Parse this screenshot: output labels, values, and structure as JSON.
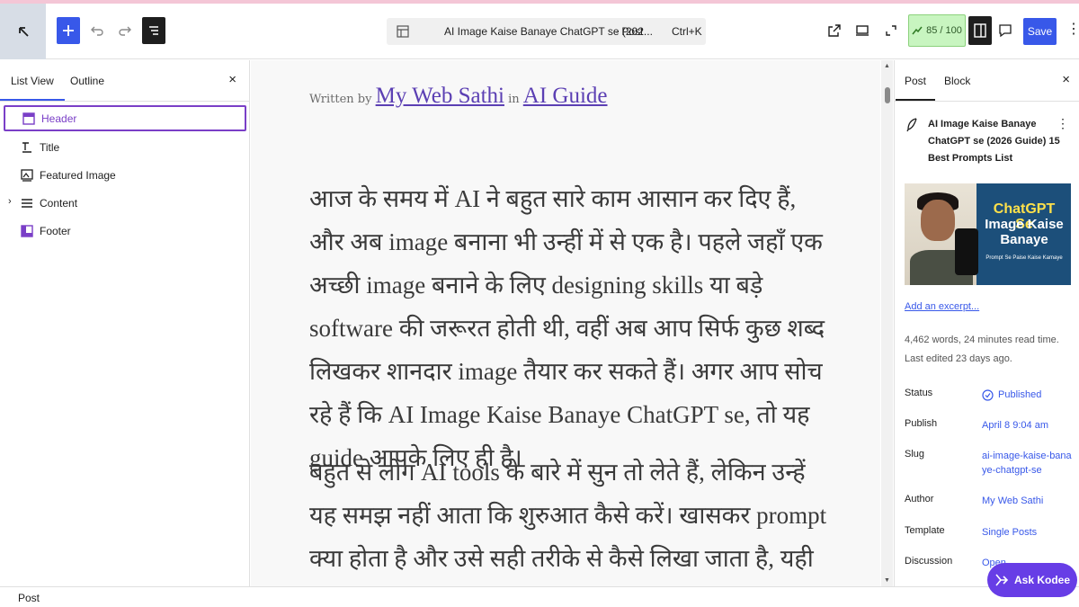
{
  "toolbar": {
    "doc_title": "AI Image Kaise Banaye ChatGPT se (202...",
    "doc_type": "· Post",
    "doc_shortcut": "Ctrl+K",
    "seo_score": "85 / 100",
    "save_label": "Save",
    "more_glyph": "⋮"
  },
  "left_panel": {
    "tabs": [
      {
        "label": "List View"
      },
      {
        "label": "Outline"
      }
    ],
    "close_glyph": "×",
    "items": [
      {
        "label": "Header"
      },
      {
        "label": "Title"
      },
      {
        "label": "Featured Image"
      },
      {
        "label": "Content"
      },
      {
        "label": "Footer"
      }
    ]
  },
  "canvas": {
    "byline_prefix": "Written by",
    "author": "My Web Sathi",
    "in_label": "in",
    "category": "AI Guide",
    "paragraphs": [
      "आज के समय में AI ने बहुत सारे काम आसान कर दिए हैं, और अब image बनाना भी उन्हीं में से एक है। पहले जहाँ एक अच्छी image बनाने के लिए designing skills या बड़े software की जरूरत होती थी, वहीं अब आप सिर्फ कुछ शब्द लिखकर शानदार image तैयार कर सकते हैं। अगर आप सोच रहे हैं कि AI Image Kaise Banaye ChatGPT se, तो यह guide आपके लिए ही है।",
      "बहुत से लोग AI tools के बारे में सुन तो लेते हैं, लेकिन उन्हें यह समझ नहीं आता कि शुरुआत कैसे करें। खासकर prompt क्या होता है और उसे सही तरीके से कैसे लिखा जाता है, यही सबसे बड़ा"
    ]
  },
  "right_panel": {
    "tabs": [
      {
        "label": "Post"
      },
      {
        "label": "Block"
      }
    ],
    "close_glyph": "×",
    "post_title": "AI Image Kaise Banaye ChatGPT se (2026 Guide) 15 Best Prompts List",
    "kebab_glyph": "⋮",
    "thumbnail": {
      "headline_1": "ChatGPT Se",
      "headline_2": "Image Kaise Banaye",
      "tagline": "Prompt Se Paise Kaise Kamaye"
    },
    "excerpt_link": "Add an excerpt...",
    "stats": "4,462 words, 24 minutes read time.",
    "last_edited": "Last edited 23 days ago.",
    "fields": [
      {
        "label": "Status",
        "value": "Published"
      },
      {
        "label": "Publish",
        "value": "April 8 9:04 am"
      },
      {
        "label": "Slug",
        "value": "ai-image-kaise-banaye-chatgpt-se"
      },
      {
        "label": "Author",
        "value": "My Web Sathi"
      },
      {
        "label": "Template",
        "value": "Single Posts"
      },
      {
        "label": "Discussion",
        "value": "Open"
      }
    ]
  },
  "bottom_bar": {
    "breadcrumb": "Post"
  },
  "assistant": {
    "label": "Ask Kodee"
  },
  "colors": {
    "accent": "#3858e9",
    "selection": "#7a3fc7",
    "seo_badge": "#c8f5c0",
    "kodee": "#673de6"
  }
}
